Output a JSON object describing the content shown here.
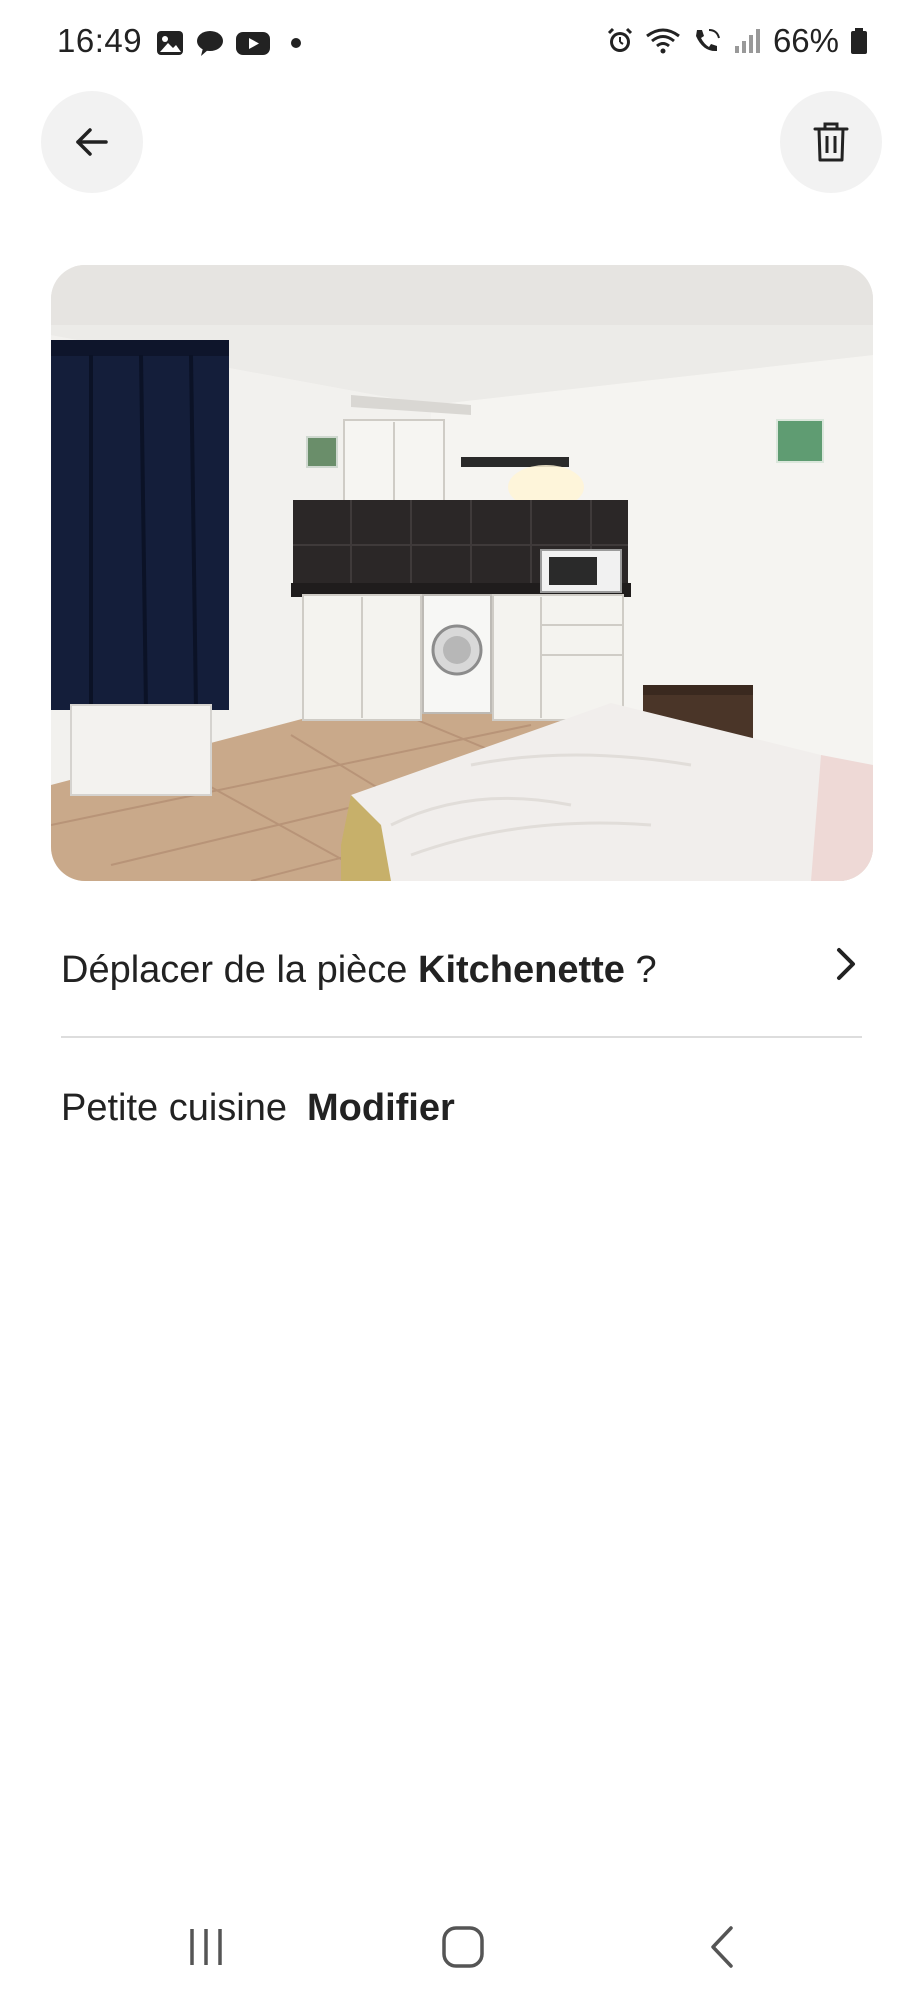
{
  "status_bar": {
    "time": "16:49",
    "battery": "66%",
    "left_icons": [
      "gallery-icon",
      "chat-icon",
      "youtube-icon",
      "dot-icon"
    ],
    "right_icons": [
      "alarm-icon",
      "wifi-icon",
      "wifi-call-icon",
      "signal-icon",
      "battery-icon"
    ]
  },
  "header": {
    "back_icon": "arrow-left-icon",
    "delete_icon": "trash-icon"
  },
  "photo": {
    "subject": "kitchenette"
  },
  "room": {
    "prefix": "Déplacer de la pièce ",
    "name": "Kitchenette",
    "suffix": " ?"
  },
  "caption": {
    "text": "Petite cuisine",
    "edit_label": "Modifier"
  },
  "nav_bar": {
    "items": [
      "recents-icon",
      "home-icon",
      "back-icon"
    ]
  }
}
